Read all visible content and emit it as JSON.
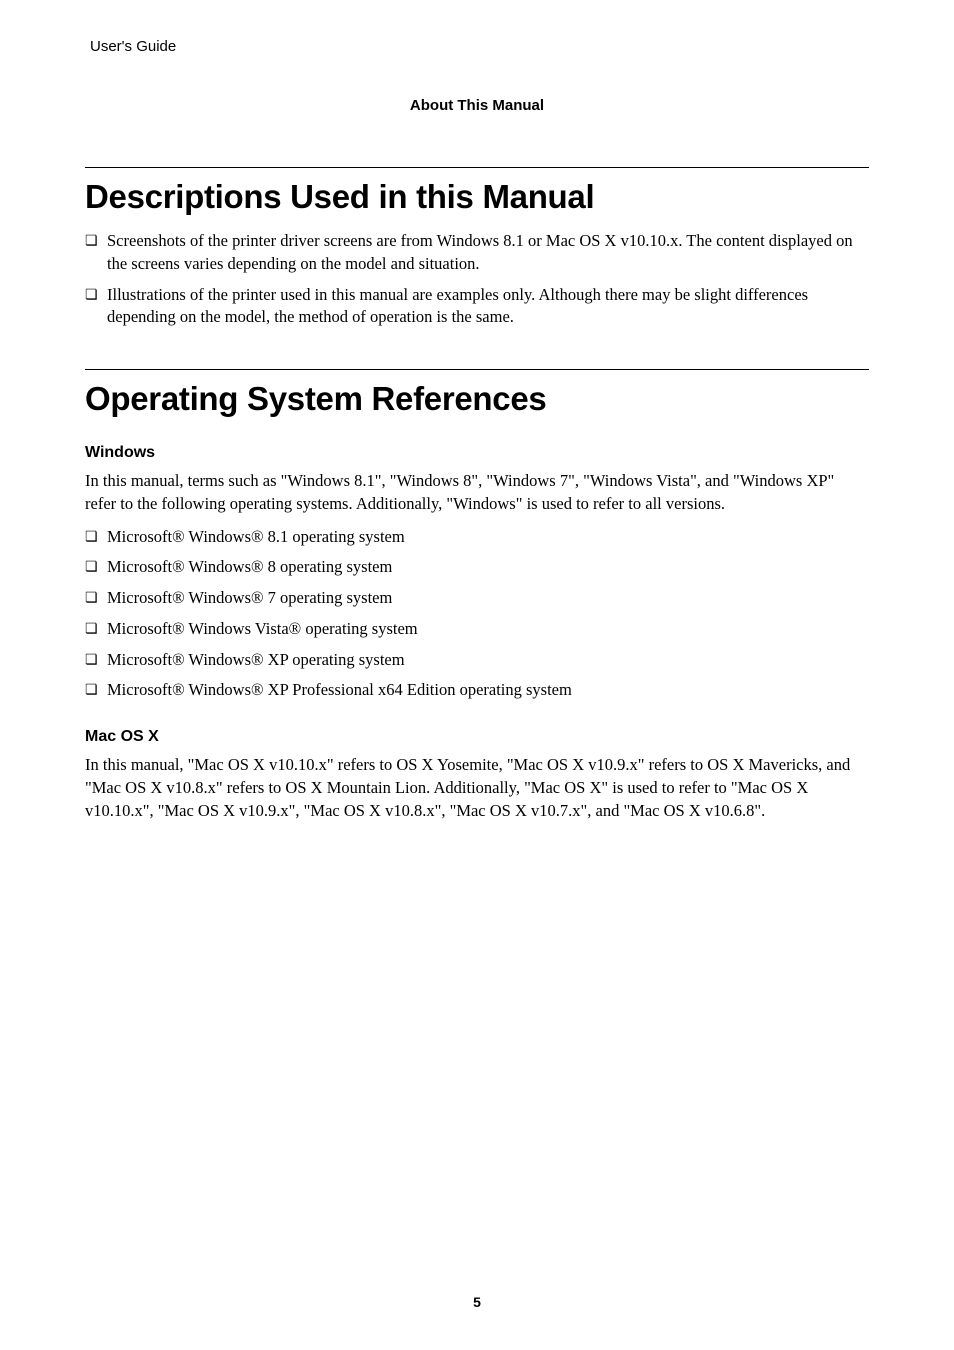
{
  "header": {
    "running_head": "User's Guide",
    "section_label": "About This Manual"
  },
  "sections": [
    {
      "title": "Descriptions Used in this Manual",
      "bullets": [
        "Screenshots of the printer driver screens are from Windows 8.1 or Mac OS X v10.10.x. The content displayed on the screens varies depending on the model and situation.",
        "Illustrations of the printer used in this manual are examples only. Although there may be slight differences depending on the model, the method of operation is the same."
      ]
    },
    {
      "title": "Operating System References",
      "subsections": [
        {
          "heading": "Windows",
          "intro": "In this manual, terms such as \"Windows 8.1\", \"Windows 8\", \"Windows 7\", \"Windows Vista\", and \"Windows XP\" refer to the following operating systems. Additionally, \"Windows\" is used to refer to all versions.",
          "items": [
            "Microsoft® Windows® 8.1 operating system",
            "Microsoft® Windows® 8 operating system",
            "Microsoft® Windows® 7 operating system",
            "Microsoft® Windows Vista® operating system",
            "Microsoft® Windows® XP operating system",
            "Microsoft® Windows® XP Professional x64 Edition operating system"
          ]
        },
        {
          "heading": "Mac OS X",
          "intro": "In this manual, \"Mac OS X v10.10.x\" refers to OS X Yosemite, \"Mac OS X v10.9.x\" refers to OS X Mavericks, and \"Mac OS X v10.8.x\" refers to OS X Mountain Lion. Additionally, \"Mac OS X\" is used to refer to \"Mac OS X v10.10.x\", \"Mac OS X v10.9.x\", \"Mac OS X v10.8.x\", \"Mac OS X v10.7.x\", and \"Mac OS X v10.6.8\"."
        }
      ]
    }
  ],
  "page_number": "5"
}
